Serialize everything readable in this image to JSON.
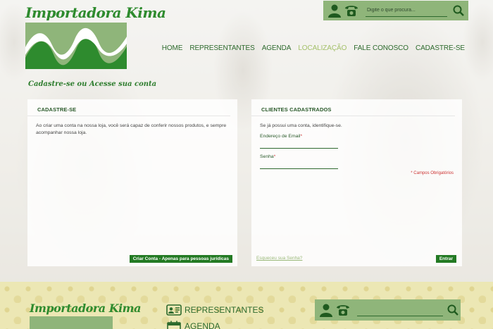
{
  "brand": {
    "name": "Importadora Kima",
    "tagline": "Cadastre-se ou Acesse sua conta"
  },
  "topbar": {
    "search_placeholder": "Digite o que procura..."
  },
  "nav": {
    "items": [
      {
        "label": "HOME"
      },
      {
        "label": "REPRESENTANTES"
      },
      {
        "label": "AGENDA"
      },
      {
        "label": "LOCALIZAÇÃO"
      },
      {
        "label": "FALE CONOSCO"
      },
      {
        "label": "CADASTRE-SE"
      }
    ]
  },
  "register": {
    "title": "CADASTRE-SE",
    "text": "Ao criar uma conta na nossa loja, você será capaz de conferir nossos produtos, e sempre acompanhar nossa loja.",
    "button": "Criar Conta - Apenas para pessoas jurídicas"
  },
  "login": {
    "title": "CLIENTES CADASTRADOS",
    "text": "Se já possui uma conta, identifique-se.",
    "email_label": "Endereço de Email",
    "password_label": "Senha",
    "required_marker": "*",
    "required_note": "* Campos Obrigatórios",
    "forgot": "Esqueceu sua Senha?",
    "button": "Entrar"
  },
  "footer": {
    "logo_text": "Importadora Kima",
    "links": [
      {
        "label": "REPRESENTANTES"
      },
      {
        "label": "AGENDA"
      }
    ]
  },
  "colors": {
    "brand_green": "#2e8b2e",
    "light_green": "#8fb57a",
    "button_green": "#237a23",
    "nav_active": "#a3c06a",
    "required_red": "#cc3333"
  }
}
